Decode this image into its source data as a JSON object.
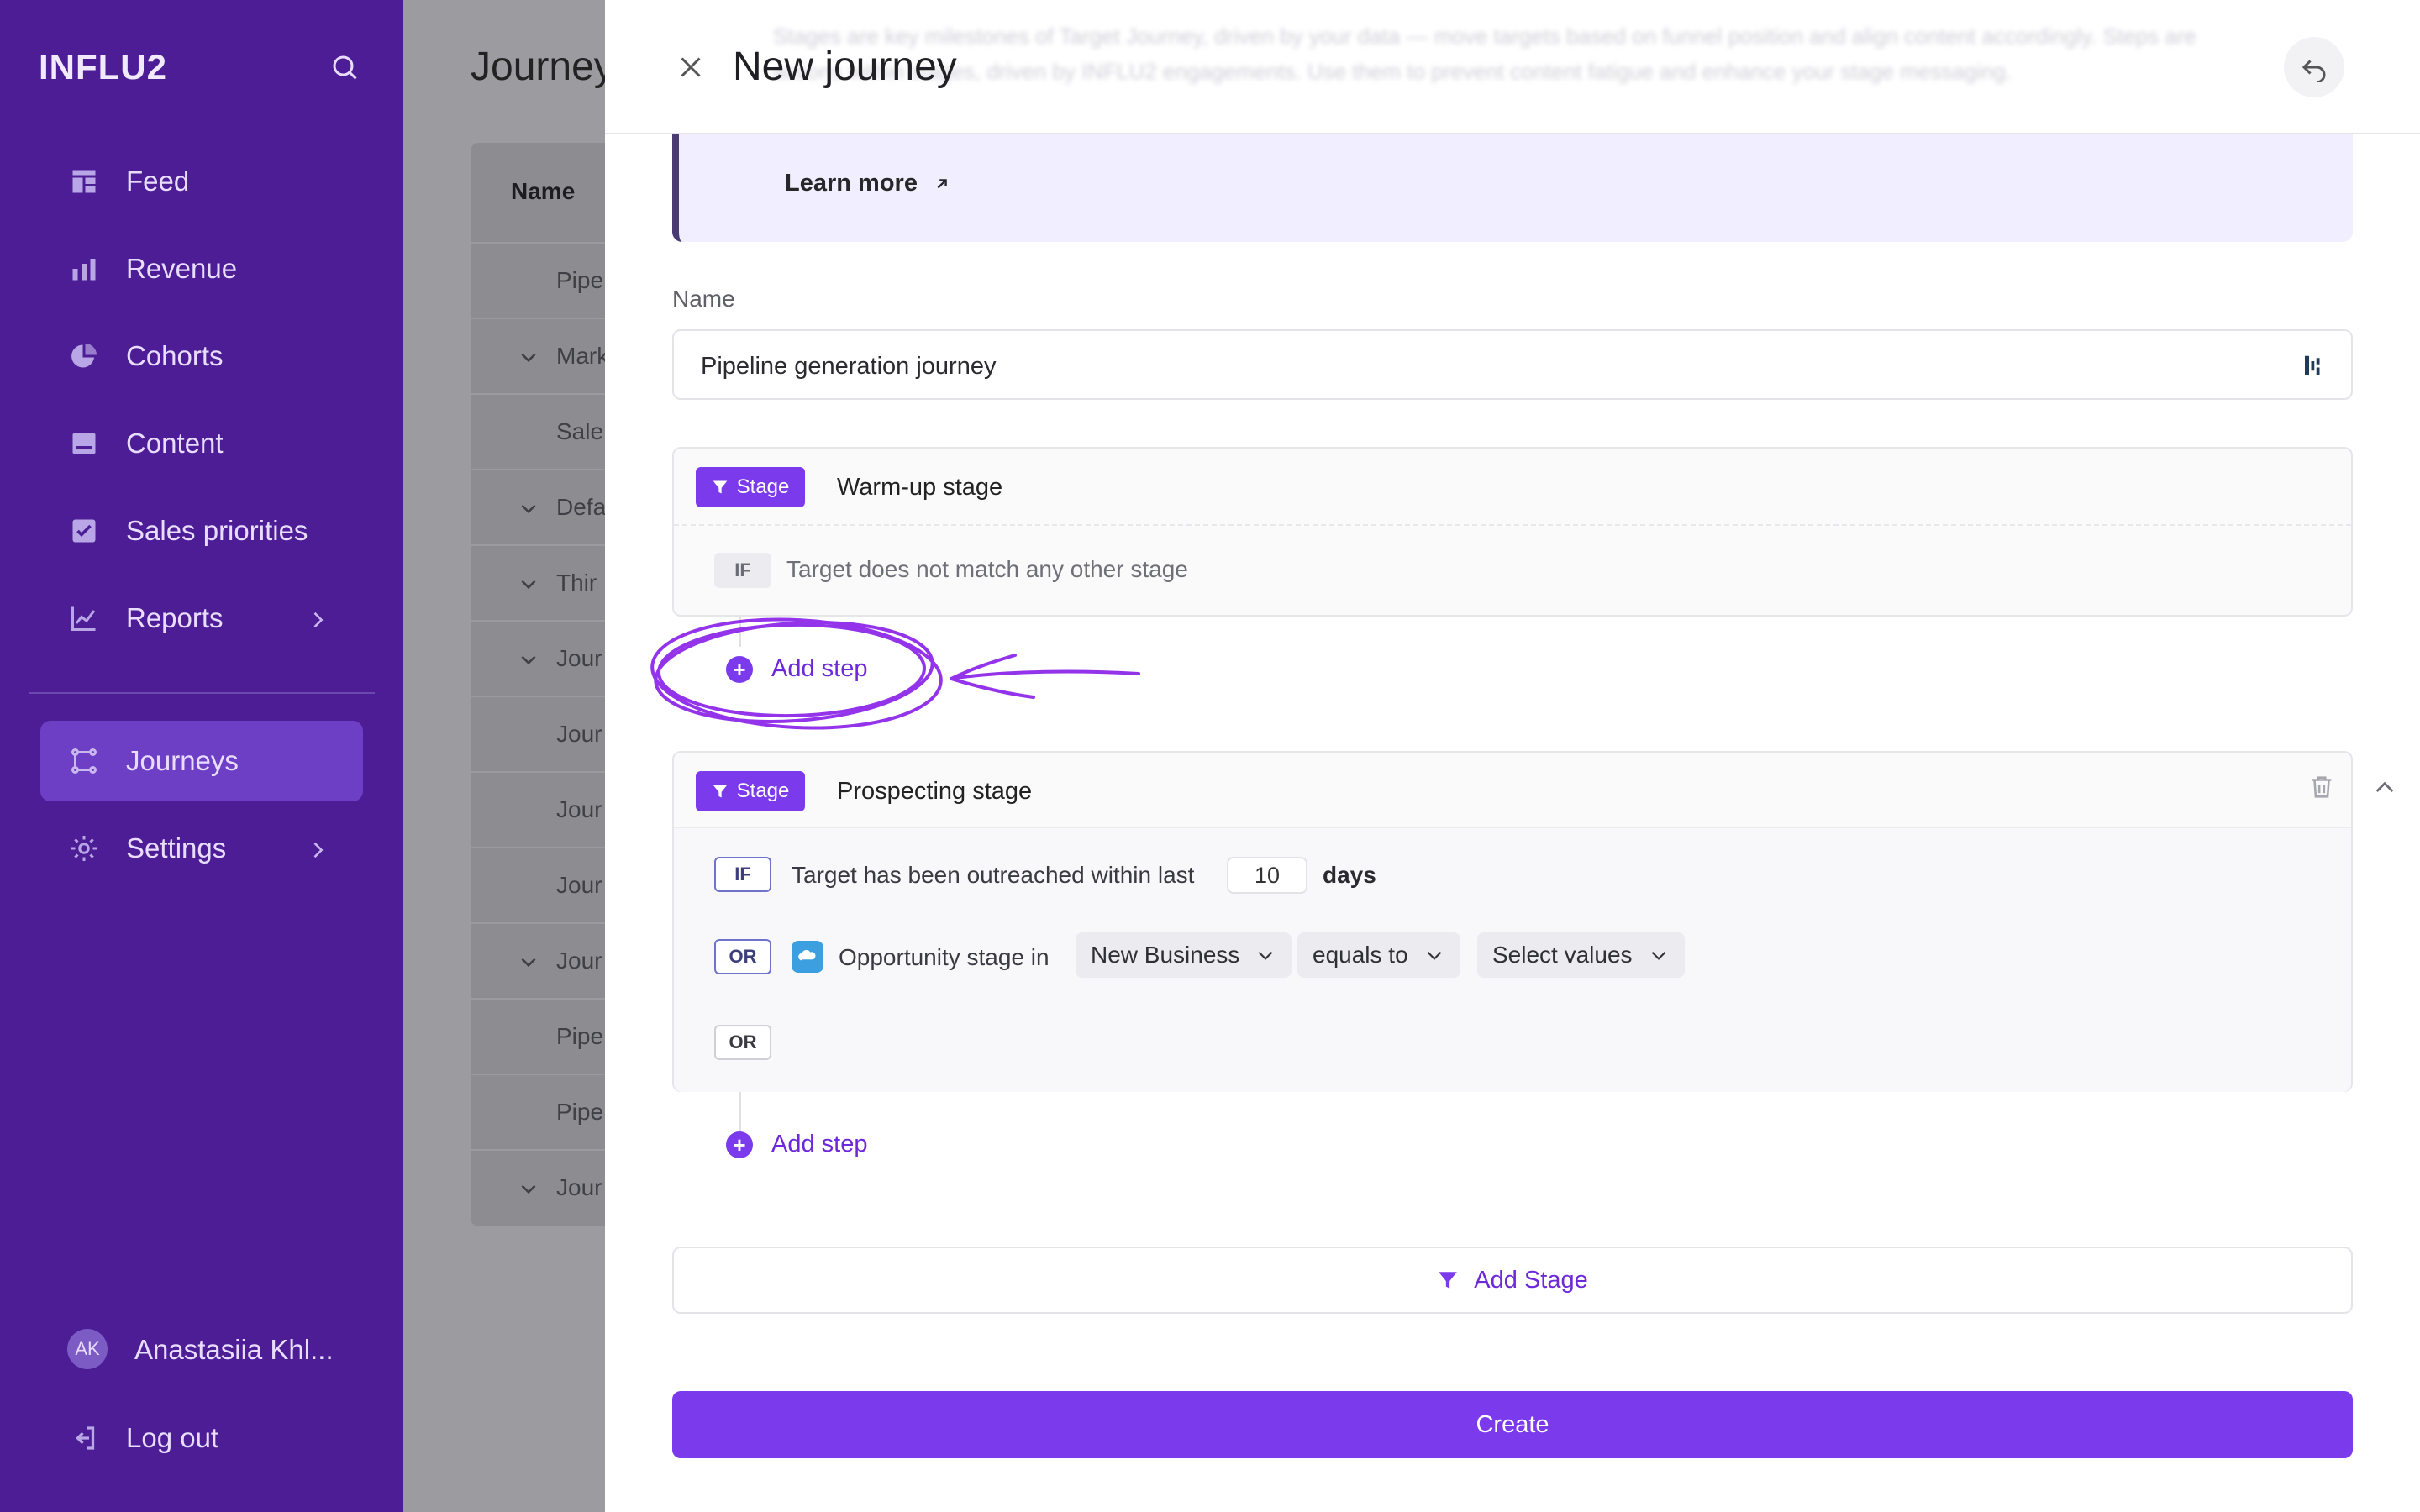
{
  "sidebar": {
    "logo": "INFLU2",
    "items": [
      {
        "label": "Feed",
        "icon": "feed-icon"
      },
      {
        "label": "Revenue",
        "icon": "bar-chart-icon"
      },
      {
        "label": "Cohorts",
        "icon": "pie-chart-icon"
      },
      {
        "label": "Content",
        "icon": "content-icon"
      },
      {
        "label": "Sales priorities",
        "icon": "checkbox-icon"
      },
      {
        "label": "Reports",
        "icon": "line-chart-icon"
      },
      {
        "label": "Journeys",
        "icon": "journeys-icon",
        "active": true
      },
      {
        "label": "Settings",
        "icon": "gear-icon"
      }
    ],
    "user": {
      "initials": "AK",
      "name": "Anastasiia Khl..."
    },
    "logout": "Log out"
  },
  "background_page": {
    "title": "Journeys",
    "column_header": "Name",
    "rows": [
      "Pipe",
      "Mark",
      "Sale",
      "Defa",
      "Thir",
      "Jour",
      "Jour",
      "Jour",
      "Jour",
      "Jour",
      "Pipe",
      "Pipe",
      "Jour"
    ]
  },
  "drawer": {
    "title": "New journey",
    "info_blurred": "Stages are key milestones of Target Journey, driven by your data — move targets based on funnel position and align content accordingly. Steps are actions within stages, driven by INFLU2 engagements. Use them to prevent content fatigue and enhance your stage messaging.",
    "learn_more": "Learn more",
    "name_label": "Name",
    "name_value": "Pipeline generation journey",
    "stages": [
      {
        "badge": "Stage",
        "name": "Warm-up stage",
        "condition_tag": "IF",
        "condition_text": "Target does not match any other stage",
        "add_step": "Add step"
      },
      {
        "badge": "Stage",
        "name": "Prospecting stage",
        "if_tag": "IF",
        "if_text": "Target has been outreached within last",
        "days_value": "10",
        "days_unit": "days",
        "or_tag": "OR",
        "or_text": "Opportunity stage in",
        "dropdown_1": "New Business",
        "dropdown_2": "equals to",
        "dropdown_3": "Select values",
        "or_tag_2": "OR",
        "add_step": "Add step"
      }
    ],
    "add_stage": "Add Stage",
    "create": "Create"
  },
  "colors": {
    "sidebar_bg": "#4c1d95",
    "accent": "#7c3aed",
    "annotation": "#9333ea"
  }
}
